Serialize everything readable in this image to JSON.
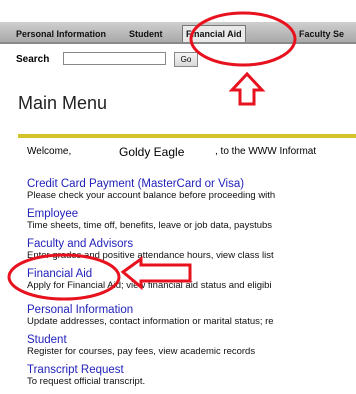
{
  "tabs": [
    {
      "label": "Personal Information"
    },
    {
      "label": "Student"
    },
    {
      "label": "Financial Aid"
    },
    {
      "label": "Faculty Se"
    }
  ],
  "search": {
    "label": "Search",
    "value": "",
    "go_label": "Go"
  },
  "page_title": "Main Menu",
  "welcome": {
    "prefix": "Welcome,",
    "name": "Goldy Eagle",
    "suffix": ", to the WWW Informat"
  },
  "menu": [
    {
      "link": "Credit Card Payment (MasterCard or Visa)",
      "desc": "Please check your account balance before proceeding with"
    },
    {
      "link": "Employee",
      "desc": "Time sheets, time off, benefits, leave or job data, paystubs"
    },
    {
      "link": "Faculty and Advisors",
      "desc": "Enter grades and positive attendance hours, view class list"
    },
    {
      "link": "Financial Aid",
      "desc": "Apply for Financial Aid; view financial aid status and eligibi"
    },
    {
      "link": "Personal Information",
      "desc": "Update addresses, contact information or marital status; re"
    },
    {
      "link": "Student",
      "desc": "Register for courses, pay fees, view academic records"
    },
    {
      "link": "Transcript Request",
      "desc": "To request official transcript."
    }
  ],
  "colors": {
    "link": "#2222bb",
    "annotation": "#e8121e",
    "rule": "#d4c22a",
    "tabbar": "#bdbdbd"
  }
}
